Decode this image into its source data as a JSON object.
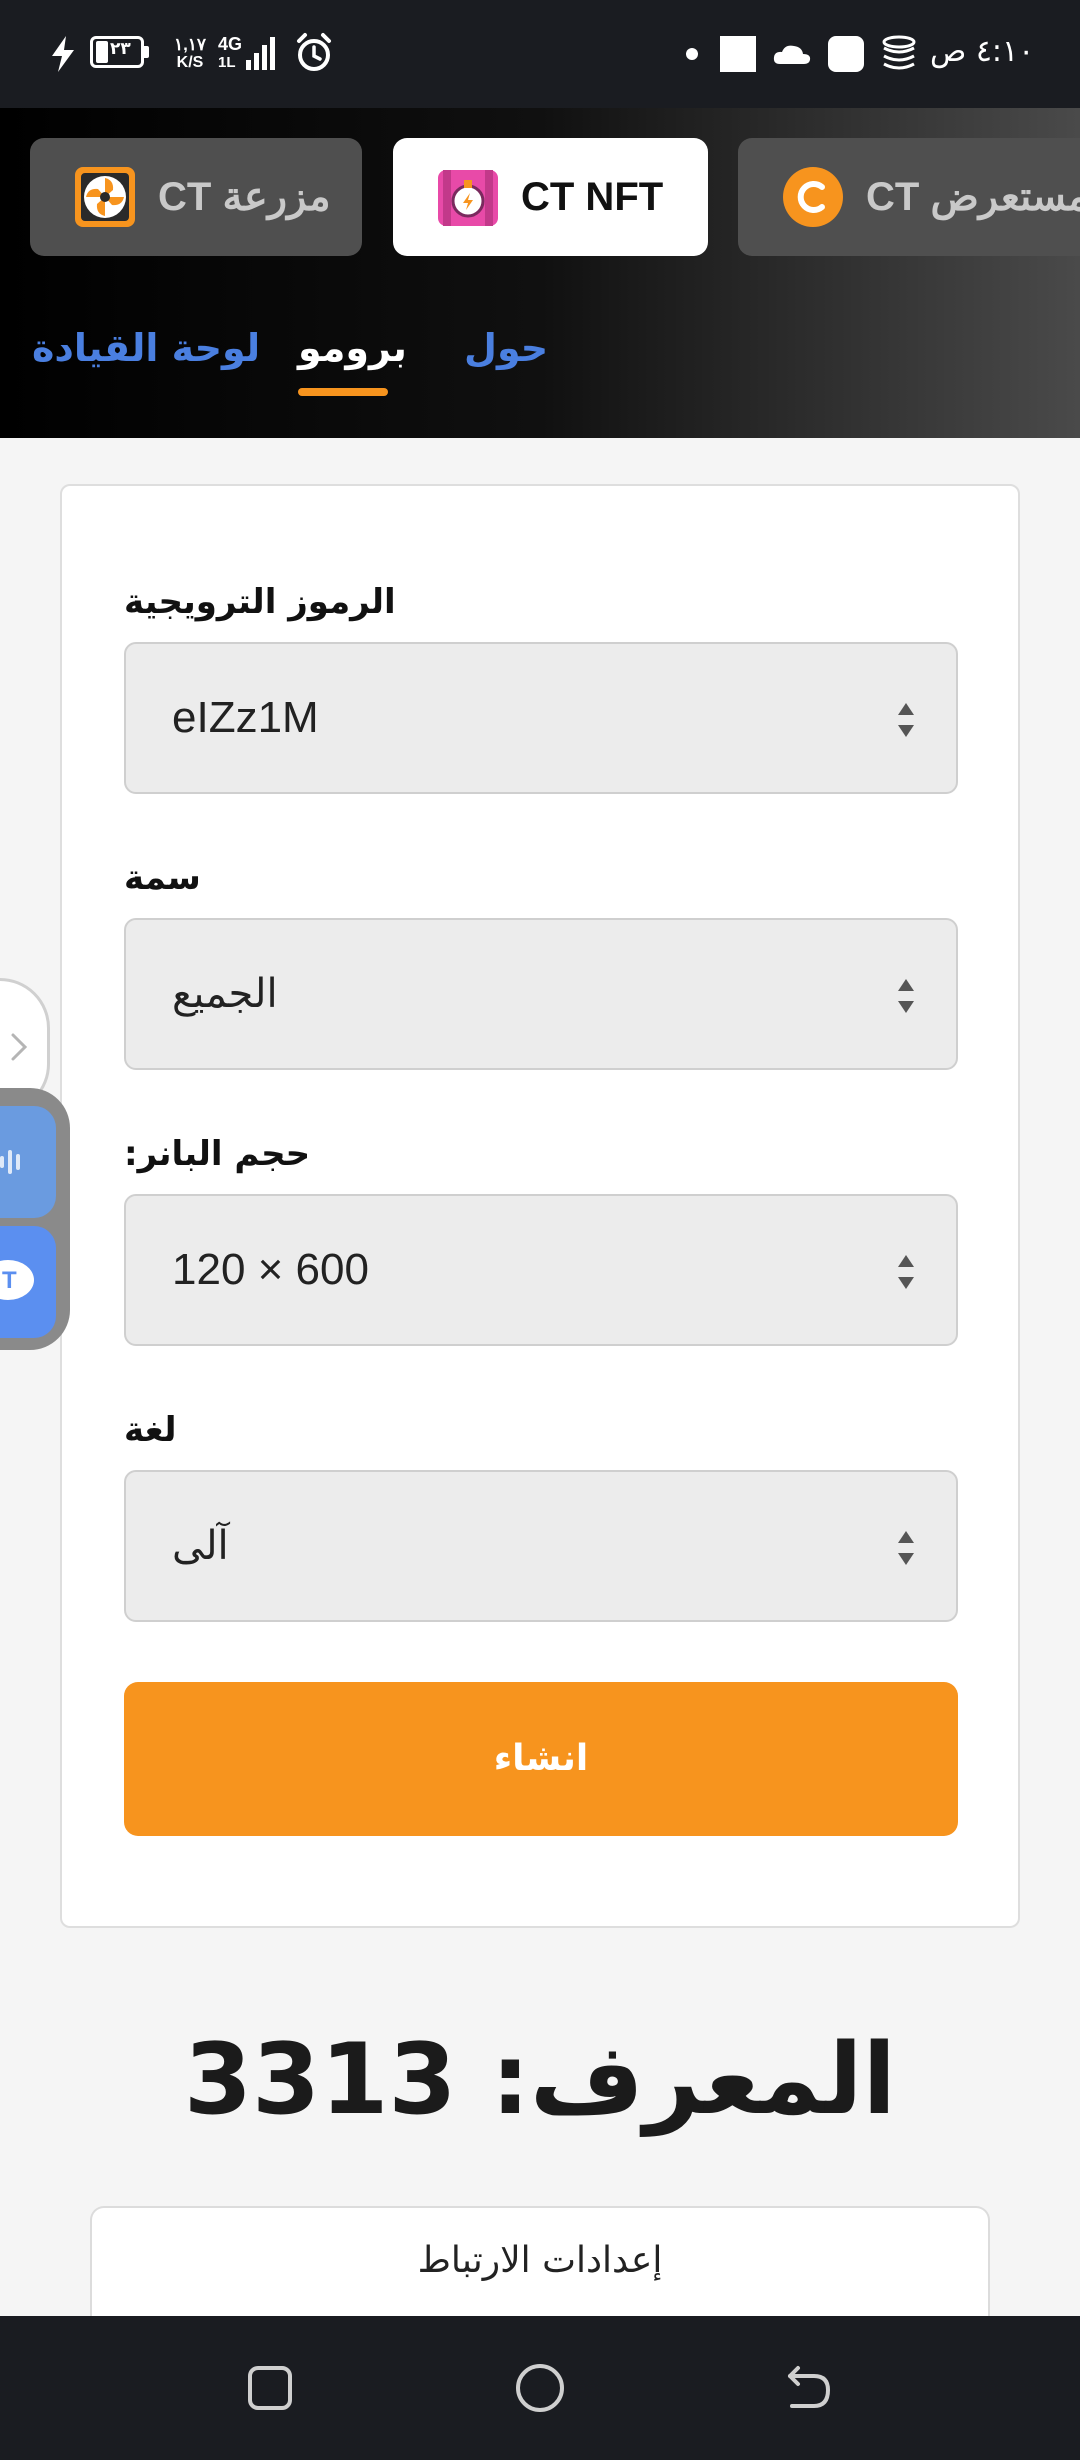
{
  "status_bar": {
    "time": "٤:١٠ ص",
    "battery": "٢٣",
    "speed_value": "١,١٧",
    "speed_unit": "K/S",
    "network": "4G",
    "network_sub": "1L"
  },
  "app_tabs": [
    {
      "label": "CT مزرعة",
      "icon": "fan-icon",
      "active": false
    },
    {
      "label": "CT NFT",
      "icon": "nft-bomb-icon",
      "active": true
    },
    {
      "label": "CT مستعرض",
      "icon": "ct-coin-icon",
      "active": false
    }
  ],
  "subnav": {
    "dashboard": "لوحة القيادة",
    "promo": "برومو",
    "about": "حول",
    "active": "promo"
  },
  "form": {
    "promo_codes": {
      "label": "الرموز الترويجية",
      "value": "eIZz1M"
    },
    "theme": {
      "label": "سمة",
      "value": "الجميع"
    },
    "banner_size": {
      "label": "حجم البانر:",
      "value": "120 × 600"
    },
    "language": {
      "label": "لغة",
      "value": "آلى"
    },
    "generate_label": "انشاء"
  },
  "id_heading": "المعرف: 3313",
  "link_settings_label": "إعدادات الارتباط",
  "colors": {
    "accent": "#f7941e",
    "link": "#4a7fe0",
    "status_bar": "#1a1c21"
  }
}
